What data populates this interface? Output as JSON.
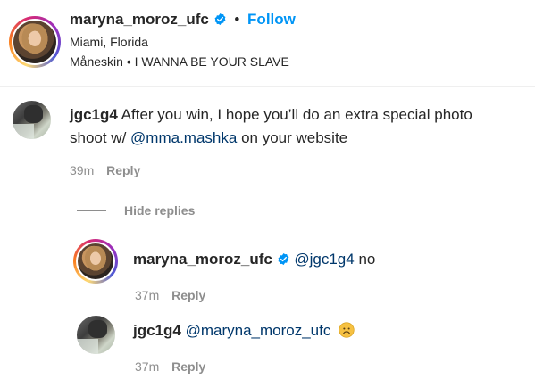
{
  "post_header": {
    "username": "maryna_moroz_ufc",
    "separator": "•",
    "follow_label": "Follow",
    "location": "Miami, Florida",
    "music_artist": "Måneskin",
    "music_separator": "•",
    "music_track": "I WANNA BE YOUR SLAVE"
  },
  "comment": {
    "username": "jgc1g4",
    "text_before": "After you win, I hope you’ll do an extra special photo",
    "text_line2_before": "shoot w/ ",
    "mention": "@mma.mashka",
    "text_after": " on your website",
    "time": "39m",
    "reply_label": "Reply"
  },
  "hide_replies_label": "Hide replies",
  "replies": [
    {
      "username": "maryna_moroz_ufc",
      "mention": "@jgc1g4",
      "text": "no",
      "time": "37m",
      "reply_label": "Reply"
    },
    {
      "username": "jgc1g4",
      "mention": "@maryna_moroz_ufc",
      "emoji": "sad-face-emoji",
      "time": "37m",
      "reply_label": "Reply"
    }
  ],
  "colors": {
    "follow": "#0095f6",
    "verified": "#0095f6",
    "mention": "#00376b",
    "meta": "#8e8e8e",
    "emoji": "#f6c142"
  }
}
